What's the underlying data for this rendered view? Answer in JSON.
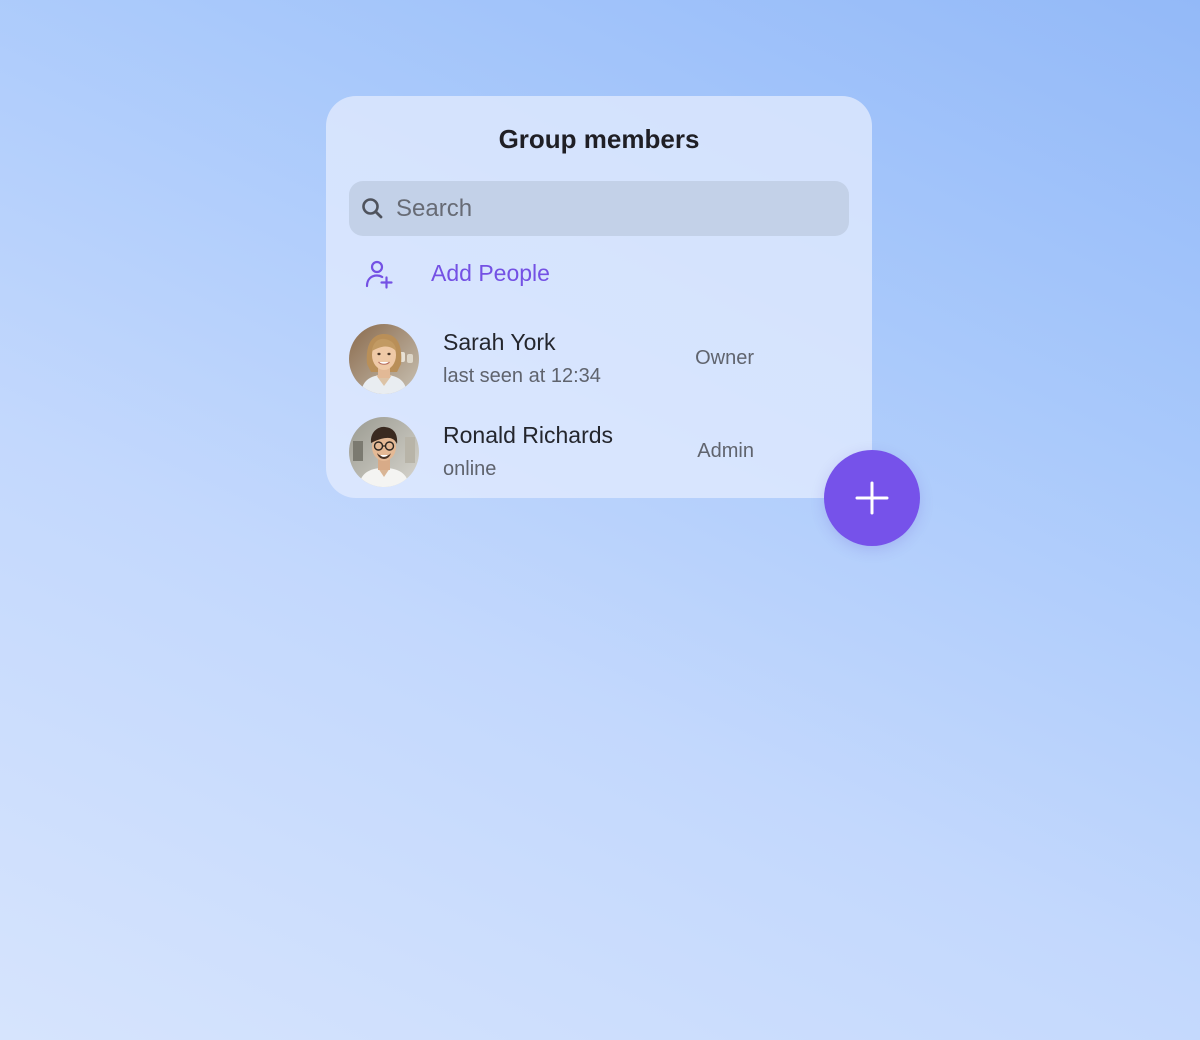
{
  "panel": {
    "title": "Group members"
  },
  "search": {
    "placeholder": "Search",
    "value": "",
    "icon": "search-icon"
  },
  "add_people": {
    "label": "Add People",
    "icon": "person-add-icon",
    "color": "#7451e4"
  },
  "members": [
    {
      "name": "Sarah York",
      "status": "last seen at 12:34",
      "role": "Owner",
      "avatar": "avatar-photo"
    },
    {
      "name": "Ronald Richards",
      "status": "online",
      "role": "Admin",
      "avatar": "avatar-photo"
    }
  ],
  "fab": {
    "icon": "plus-icon",
    "color": "#7652ea"
  }
}
